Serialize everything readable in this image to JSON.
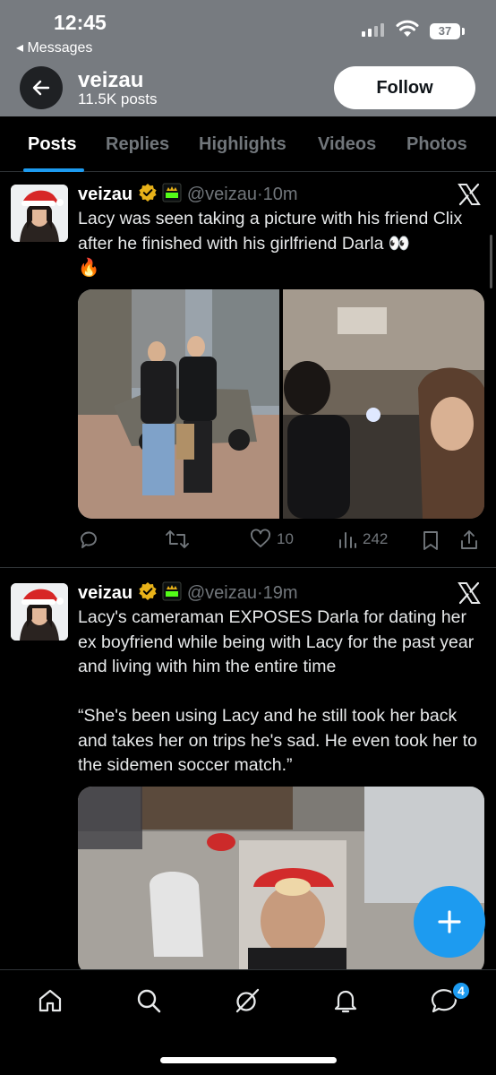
{
  "status_bar": {
    "time": "12:45",
    "back_app": "◂ Messages",
    "battery": "37"
  },
  "header": {
    "name": "veizau",
    "posts": "11.5K posts",
    "follow_label": "Follow"
  },
  "tabs": [
    {
      "label": "Posts",
      "active": true
    },
    {
      "label": "Replies",
      "active": false
    },
    {
      "label": "Highlights",
      "active": false
    },
    {
      "label": "Videos",
      "active": false
    },
    {
      "label": "Photos",
      "active": false
    }
  ],
  "tweets": [
    {
      "name": "veizau",
      "handle": "@veizau",
      "time": "·10m",
      "text": "Lacy was seen taking a picture with his friend Clix after he finished with his girlfriend Darla 👀\n🔥",
      "replies": "",
      "reposts": "",
      "likes": "10",
      "views": "242"
    },
    {
      "name": "veizau",
      "handle": "@veizau",
      "time": "·19m",
      "text": "Lacy's cameraman EXPOSES Darla for dating her ex boyfriend while being with Lacy for the past year and living with him the entire time\n\n“She's been using Lacy and he still took her back and takes her on trips he's sad. He even took her to the sidemen soccer match.”"
    }
  ],
  "icons": {
    "verified": "verified-badge-icon",
    "kick": "kick-badge-icon",
    "x_logo": "x-logo-icon"
  },
  "colors": {
    "accent": "#1d9bf0",
    "verified_gold": "#e8b219",
    "kick_green": "#53fc18"
  },
  "nav": {
    "messages_badge": "4"
  }
}
